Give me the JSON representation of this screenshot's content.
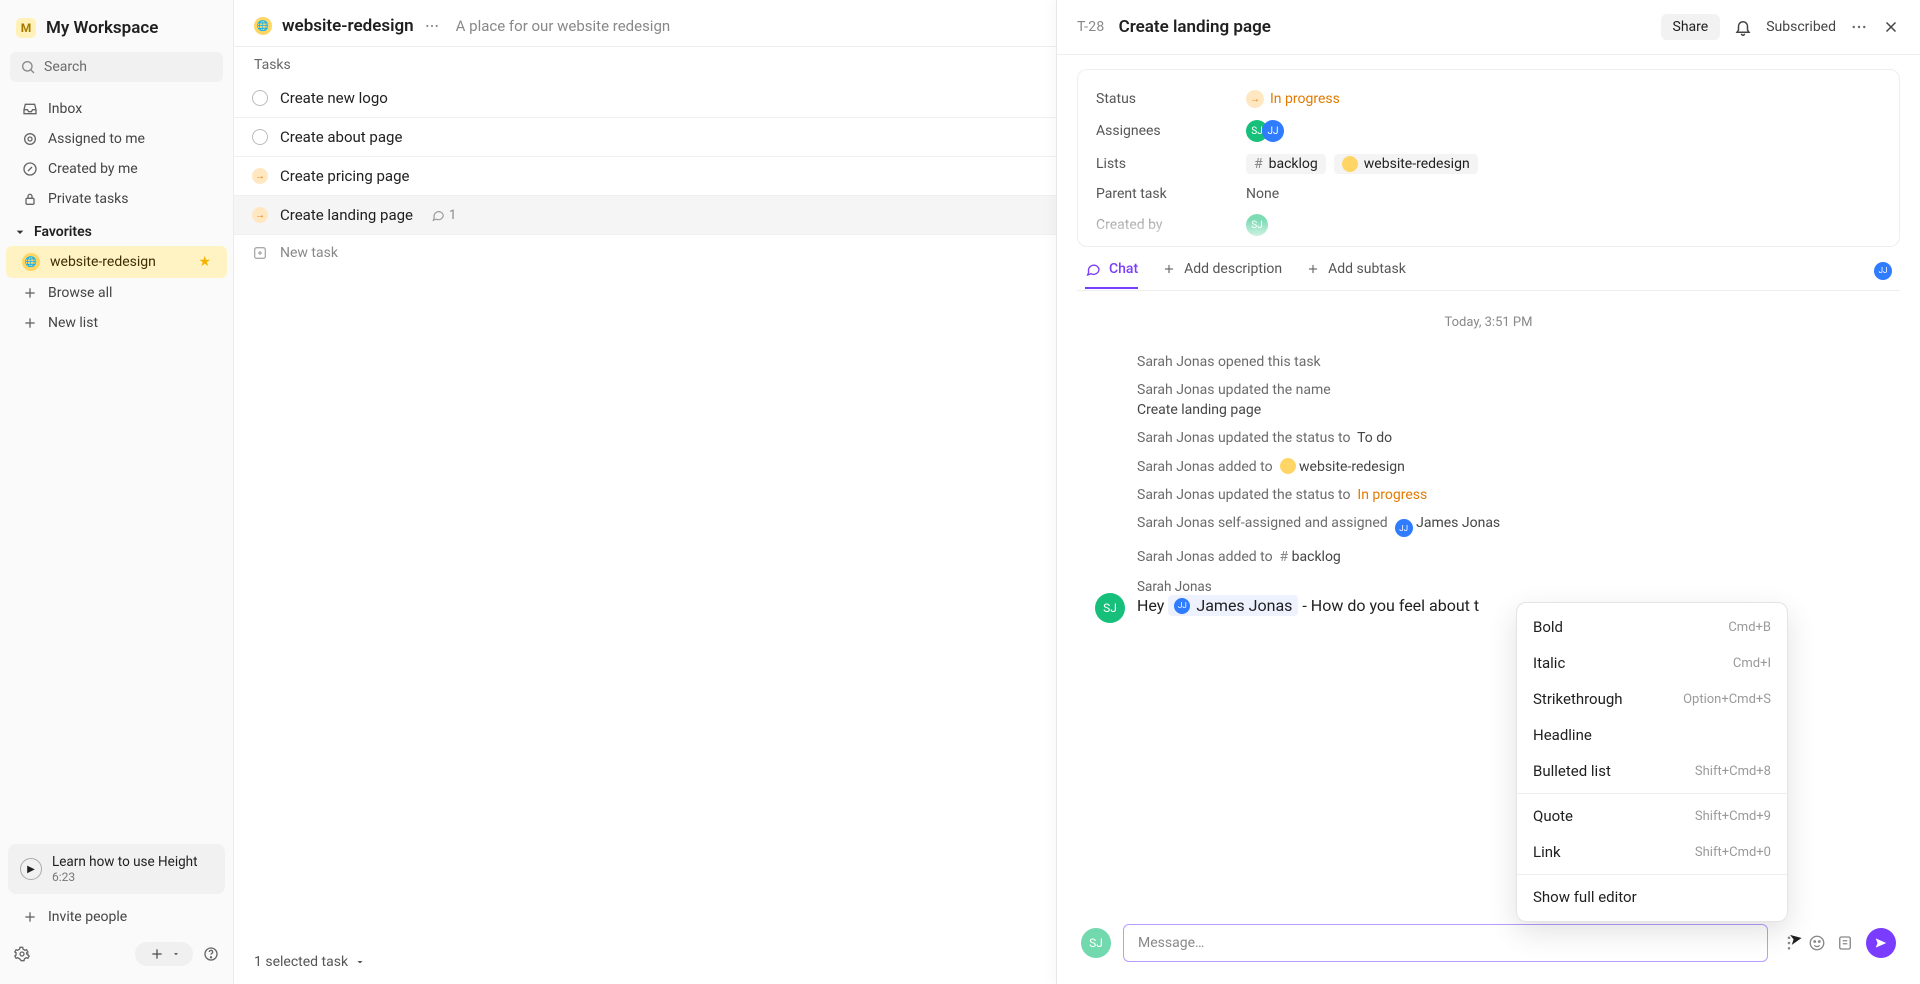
{
  "workspace": {
    "badge": "M",
    "name": "My Workspace"
  },
  "search": {
    "placeholder": "Search"
  },
  "nav": {
    "inbox": "Inbox",
    "assigned": "Assigned to me",
    "created": "Created by me",
    "private": "Private tasks"
  },
  "favorites": {
    "header": "Favorites",
    "items": [
      {
        "label": "website-redesign"
      }
    ]
  },
  "sidebar_actions": {
    "browse": "Browse all",
    "new_list": "New list"
  },
  "learn": {
    "title": "Learn how to use Height",
    "duration": "6:23"
  },
  "invite": "Invite people",
  "project": {
    "name": "website-redesign",
    "description": "A place for our website redesign"
  },
  "tasks_label": "Tasks",
  "tasks": [
    {
      "name": "Create new logo",
      "status": "todo"
    },
    {
      "name": "Create about page",
      "status": "todo"
    },
    {
      "name": "Create pricing page",
      "status": "inprog"
    },
    {
      "name": "Create landing page",
      "status": "inprog",
      "comments": "1"
    }
  ],
  "new_task": "New task",
  "selection_footer": "1 selected task",
  "detail": {
    "id": "T-28",
    "title": "Create landing page",
    "share": "Share",
    "subscribed": "Subscribed",
    "meta": {
      "status_label": "Status",
      "status_value": "In progress",
      "assignees_label": "Assignees",
      "lists_label": "Lists",
      "list_backlog": "backlog",
      "list_project": "website-redesign",
      "parent_label": "Parent task",
      "parent_value": "None",
      "createdby_label": "Created by"
    },
    "tabs": {
      "chat": "Chat",
      "add_desc": "Add description",
      "add_subtask": "Add subtask"
    },
    "day": "Today, 3:51 PM",
    "activity": {
      "opened": "Sarah Jonas opened this task",
      "renamed_label": "Sarah Jonas updated the name",
      "renamed_value": "Create landing page",
      "status_todo_prefix": "Sarah Jonas updated the status to",
      "status_todo": "To do",
      "added_proj_prefix": "Sarah Jonas added to",
      "added_proj": "website-redesign",
      "status_inprog_prefix": "Sarah Jonas updated the status to",
      "status_inprog": "In progress",
      "assigned_prefix": "Sarah Jonas self-assigned and assigned",
      "assigned_name": "James Jonas",
      "added_backlog_prefix": "Sarah Jonas added to",
      "added_backlog": "backlog",
      "msg_author": "Sarah Jonas",
      "msg_hey": "Hey",
      "msg_mention": "James Jonas",
      "msg_rest": " - How do you feel about t"
    },
    "composer_placeholder": "Message…"
  },
  "popover": {
    "items": [
      {
        "label": "Bold",
        "shortcut": "Cmd+B"
      },
      {
        "label": "Italic",
        "shortcut": "Cmd+I"
      },
      {
        "label": "Strikethrough",
        "shortcut": "Option+Cmd+S"
      },
      {
        "label": "Headline",
        "shortcut": ""
      },
      {
        "label": "Bulleted list",
        "shortcut": "Shift+Cmd+8"
      }
    ],
    "items2": [
      {
        "label": "Quote",
        "shortcut": "Shift+Cmd+9"
      },
      {
        "label": "Link",
        "shortcut": "Shift+Cmd+0"
      }
    ],
    "full_editor": "Show full editor"
  }
}
